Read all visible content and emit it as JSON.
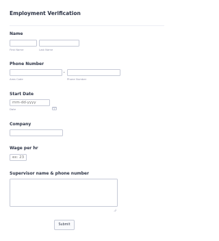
{
  "form": {
    "title": "Employment Verification"
  },
  "name": {
    "label": "Name",
    "first_sublabel": "First Name",
    "last_sublabel": "Last Name",
    "first_value": "",
    "last_value": ""
  },
  "phone": {
    "label": "Phone Number",
    "area_sublabel": "Area Code",
    "number_sublabel": "Phone Number",
    "separator": "-",
    "area_value": "",
    "number_value": ""
  },
  "start_date": {
    "label": "Start Date",
    "placeholder": "mm-dd-yyyy",
    "sublabel": "Date",
    "icon": "calendar-icon"
  },
  "company": {
    "label": "Company",
    "value": ""
  },
  "wage": {
    "label": "Wage per hr",
    "placeholder": "ex: 23"
  },
  "supervisor": {
    "label": "Supervisor name & phone number",
    "value": ""
  },
  "actions": {
    "submit_label": "Submit"
  },
  "colors": {
    "text": "#2c3345",
    "sublabel": "#8d8fa8",
    "border": "#c5c9d6",
    "icon": "#aab0c4"
  }
}
